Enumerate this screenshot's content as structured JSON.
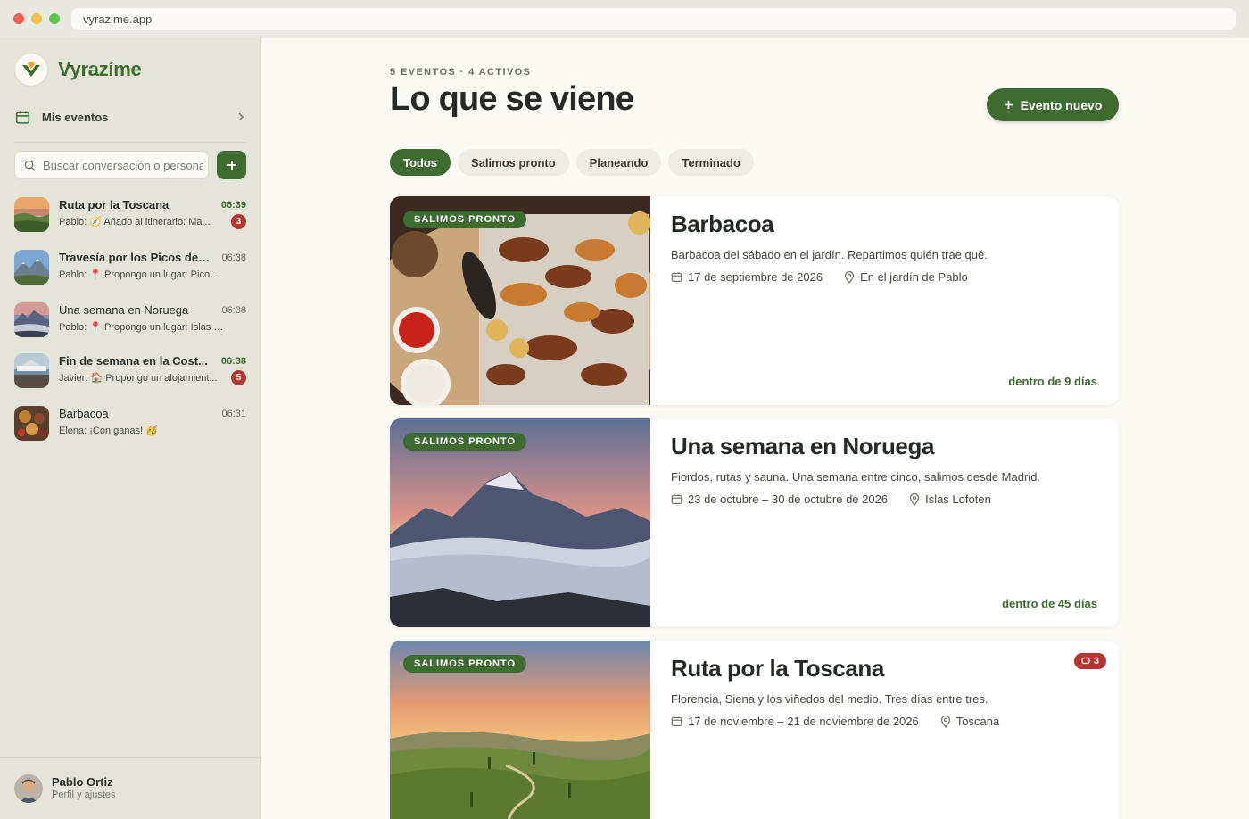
{
  "browser": {
    "url": "vyrazime.app"
  },
  "sidebar": {
    "brand": "Vyrazíme",
    "mis_eventos": "Mis eventos",
    "search_placeholder": "Buscar conversación o persona",
    "conversations": [
      {
        "title": "Ruta por la Toscana",
        "time": "06:39",
        "author": "Pablo:",
        "snippet": "Añado al itinerario: Ma...",
        "badge": "3"
      },
      {
        "title": "Travesía por los Picos de ...",
        "time": "06:38",
        "author": "Pablo:",
        "snippet": "Propongo un lugar: Picos de ...",
        "badge": ""
      },
      {
        "title": "Una semana en Noruega",
        "time": "06:38",
        "author": "Pablo:",
        "snippet": "Propongo un lugar: Islas Lofo...",
        "badge": ""
      },
      {
        "title": "Fin de semana en la Cost...",
        "time": "06:38",
        "author": "Javier:",
        "snippet": "Propongo un alojamient...",
        "badge": "5"
      },
      {
        "title": "Barbacoa",
        "time": "06:31",
        "author": "Elena:",
        "snippet": "¡Con ganas!",
        "badge": ""
      }
    ],
    "profile": {
      "name": "Pablo Ortiz",
      "sub": "Perfil y ajustes"
    }
  },
  "main": {
    "overline": "5 EVENTOS · 4 ACTIVOS",
    "title": "Lo que se viene",
    "new_event": "Evento nuevo",
    "filters": [
      "Todos",
      "Salimos pronto",
      "Planeando",
      "Terminado"
    ],
    "events": [
      {
        "tag": "SALIMOS PRONTO",
        "title": "Barbacoa",
        "desc": "Barbacoa del sábado en el jardín. Repartimos quién trae qué.",
        "date": "17 de septiembre de 2026",
        "place": "En el jardín de Pablo",
        "when": "dentro de 9 días",
        "badge": ""
      },
      {
        "tag": "SALIMOS PRONTO",
        "title": "Una semana en Noruega",
        "desc": "Fiordos, rutas y sauna. Una semana entre cinco, salimos desde Madrid.",
        "date": "23 de octubre – 30 de octubre de 2026",
        "place": "Islas Lofoten",
        "when": "dentro de 45 días",
        "badge": ""
      },
      {
        "tag": "SALIMOS PRONTO",
        "title": "Ruta por la Toscana",
        "desc": "Florencia, Siena y los viñedos del medio. Tres días entre tres.",
        "date": "17 de noviembre – 21 de noviembre de 2026",
        "place": "Toscana",
        "when": "",
        "badge": "3"
      }
    ]
  },
  "colors": {
    "accent": "#3d6b30",
    "badge": "#b4362f"
  }
}
